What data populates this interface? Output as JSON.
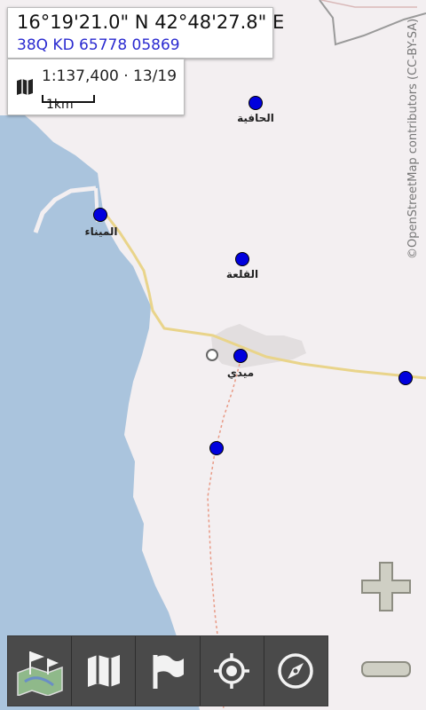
{
  "coordinates": {
    "latlon": "16°19'21.0\" N 42°48'27.8\" E",
    "mgrs": "38Q  KD  65778  05869"
  },
  "scale": {
    "text": "1:137,400 · 13/19",
    "bar_label": "1km"
  },
  "attribution": "©OpenStreetMap contributors (CC-BY-SA)",
  "places": [
    "الحافية",
    "الميناء",
    "القلعة",
    "ميدي"
  ],
  "toolbar": {
    "buttons": [
      "map-app-icon",
      "map-icon",
      "flag-icon",
      "my-location-icon",
      "compass-icon"
    ]
  },
  "zoom": {
    "in": "zoom-in-icon",
    "out": "zoom-out-icon"
  },
  "colors": {
    "land": "#f3eff1",
    "sea": "#aac4dd",
    "poi": "#0000dd",
    "mgrs_text": "#2b2bd0",
    "toolbar": "#4a4a4a"
  }
}
